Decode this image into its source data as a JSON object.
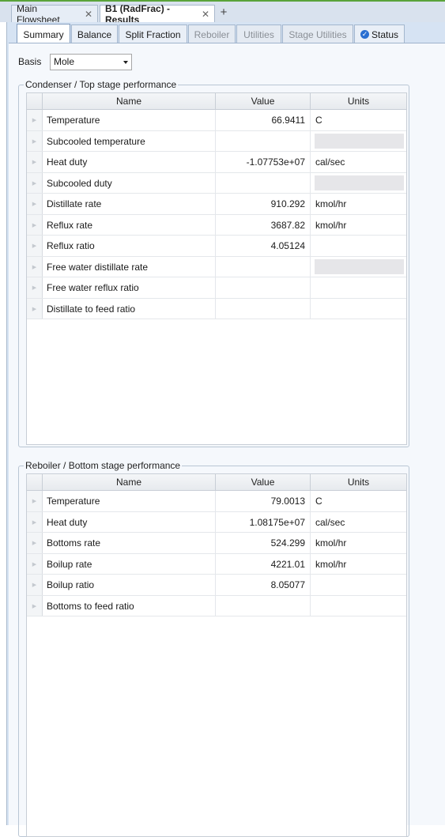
{
  "doc_tabs": [
    {
      "label": "Main Flowsheet",
      "active": false
    },
    {
      "label": "B1 (RadFrac) - Results",
      "active": true
    }
  ],
  "form_tabs": [
    {
      "label": "Summary",
      "state": "active"
    },
    {
      "label": "Balance",
      "state": "enabled"
    },
    {
      "label": "Split Fraction",
      "state": "enabled"
    },
    {
      "label": "Reboiler",
      "state": "disabled"
    },
    {
      "label": "Utilities",
      "state": "disabled"
    },
    {
      "label": "Stage Utilities",
      "state": "disabled"
    },
    {
      "label": "Status",
      "state": "enabled"
    }
  ],
  "basis": {
    "label": "Basis",
    "value": "Mole"
  },
  "columns": {
    "name": "Name",
    "value": "Value",
    "units": "Units"
  },
  "condenser": {
    "title": "Condenser / Top stage performance",
    "rows": [
      {
        "name": "Temperature",
        "value": "66.9411",
        "units": "C"
      },
      {
        "name": "Subcooled temperature",
        "value": "",
        "units": ""
      },
      {
        "name": "Heat duty",
        "value": "-1.07753e+07",
        "units": "cal/sec"
      },
      {
        "name": "Subcooled duty",
        "value": "",
        "units": ""
      },
      {
        "name": "Distillate rate",
        "value": "910.292",
        "units": "kmol/hr"
      },
      {
        "name": "Reflux rate",
        "value": "3687.82",
        "units": "kmol/hr"
      },
      {
        "name": "Reflux ratio",
        "value": "4.05124",
        "units": ""
      },
      {
        "name": "Free water distillate rate",
        "value": "",
        "units": ""
      },
      {
        "name": "Free water reflux ratio",
        "value": "",
        "units": ""
      },
      {
        "name": "Distillate to feed ratio",
        "value": "",
        "units": ""
      }
    ]
  },
  "reboiler": {
    "title": "Reboiler / Bottom stage performance",
    "rows": [
      {
        "name": "Temperature",
        "value": "79.0013",
        "units": "C"
      },
      {
        "name": "Heat duty",
        "value": "1.08175e+07",
        "units": "cal/sec"
      },
      {
        "name": "Bottoms rate",
        "value": "524.299",
        "units": "kmol/hr"
      },
      {
        "name": "Boilup rate",
        "value": "4221.01",
        "units": "kmol/hr"
      },
      {
        "name": "Boilup ratio",
        "value": "8.05077",
        "units": ""
      },
      {
        "name": "Bottoms to feed ratio",
        "value": "",
        "units": ""
      }
    ]
  }
}
